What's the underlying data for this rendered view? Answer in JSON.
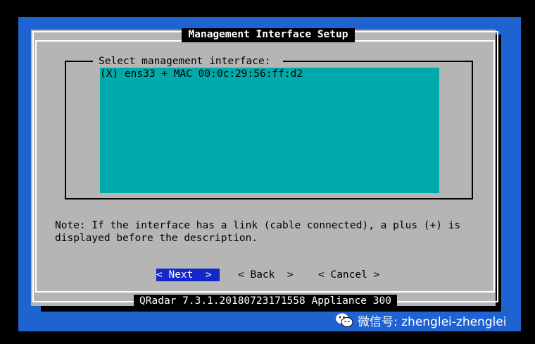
{
  "dialog": {
    "title": "Management Interface Setup",
    "list_label": "Select management interface:",
    "list_items": [
      "(X) ens33 + MAC 00:0c:29:56:ff:d2"
    ],
    "note_line1": "Note: If the interface has a link (cable connected), a plus (+) is",
    "note_line2": "displayed before the description."
  },
  "buttons": {
    "next": "< Next  >",
    "back": "< Back  >",
    "cancel": "< Cancel >"
  },
  "footer": "QRadar 7.3.1.20180723171558 Appliance 300",
  "watermark": "微信号: zhenglei-zhenglei",
  "colors": {
    "screen_background": "#1f63d1",
    "dialog_background": "#b5b5b5",
    "list_background": "#00aaaa",
    "focused_button": "#1428c8"
  }
}
